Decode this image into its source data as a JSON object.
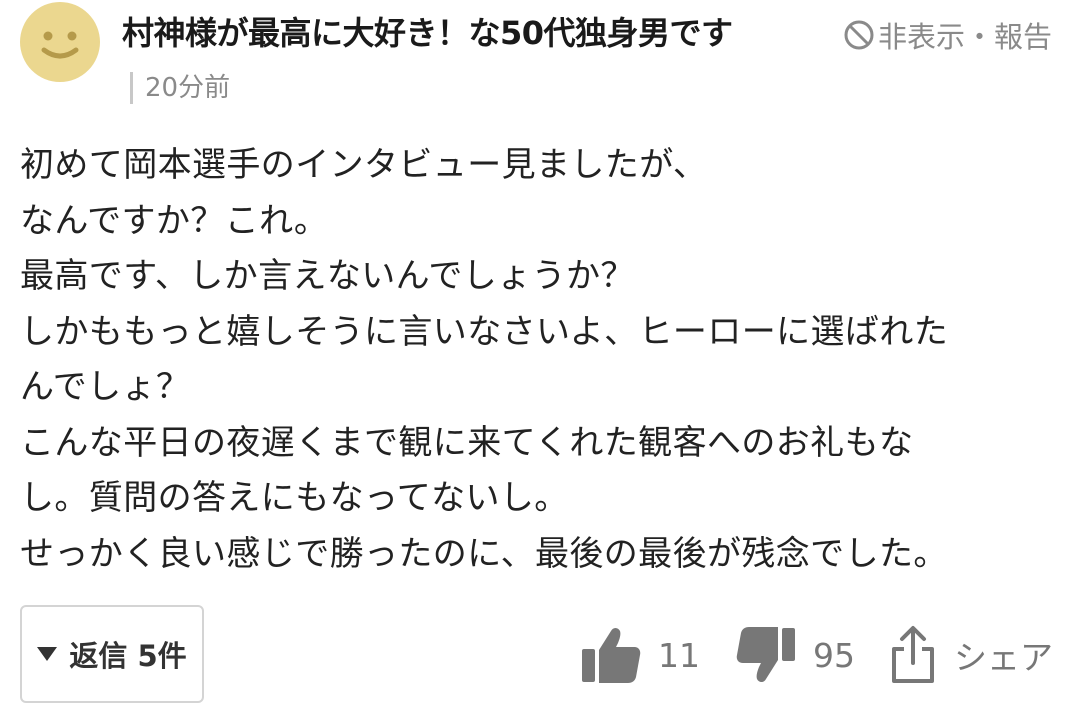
{
  "comment": {
    "avatar_icon": "smiley-face-icon",
    "username": "村神様が最高に大好き！な50代独身男です",
    "hide_report_label": "非表示・報告",
    "timestamp": "20分前",
    "body_lines": [
      "初めて岡本選手のインタビュー見ましたが、",
      "なんですか？これ。",
      "最高です、しか言えないんでしょうか？",
      "しかももっと嬉しそうに言いなさいよ、ヒーローに選ばれた",
      "んでしょ？",
      "こんな平日の夜遅くまで観に来てくれた観客へのお礼もな",
      "し。質問の答えにもなってないし。",
      "せっかく良い感じで勝ったのに、最後の最後が残念でした。"
    ]
  },
  "footer": {
    "reply_label": "返信 5件",
    "like_count": "11",
    "dislike_count": "95",
    "share_label": "シェア"
  },
  "colors": {
    "avatar_bg": "#ebd78f",
    "avatar_face": "#b59a4a",
    "muted_text": "#8a8a8a",
    "icon_gray": "#777777"
  }
}
